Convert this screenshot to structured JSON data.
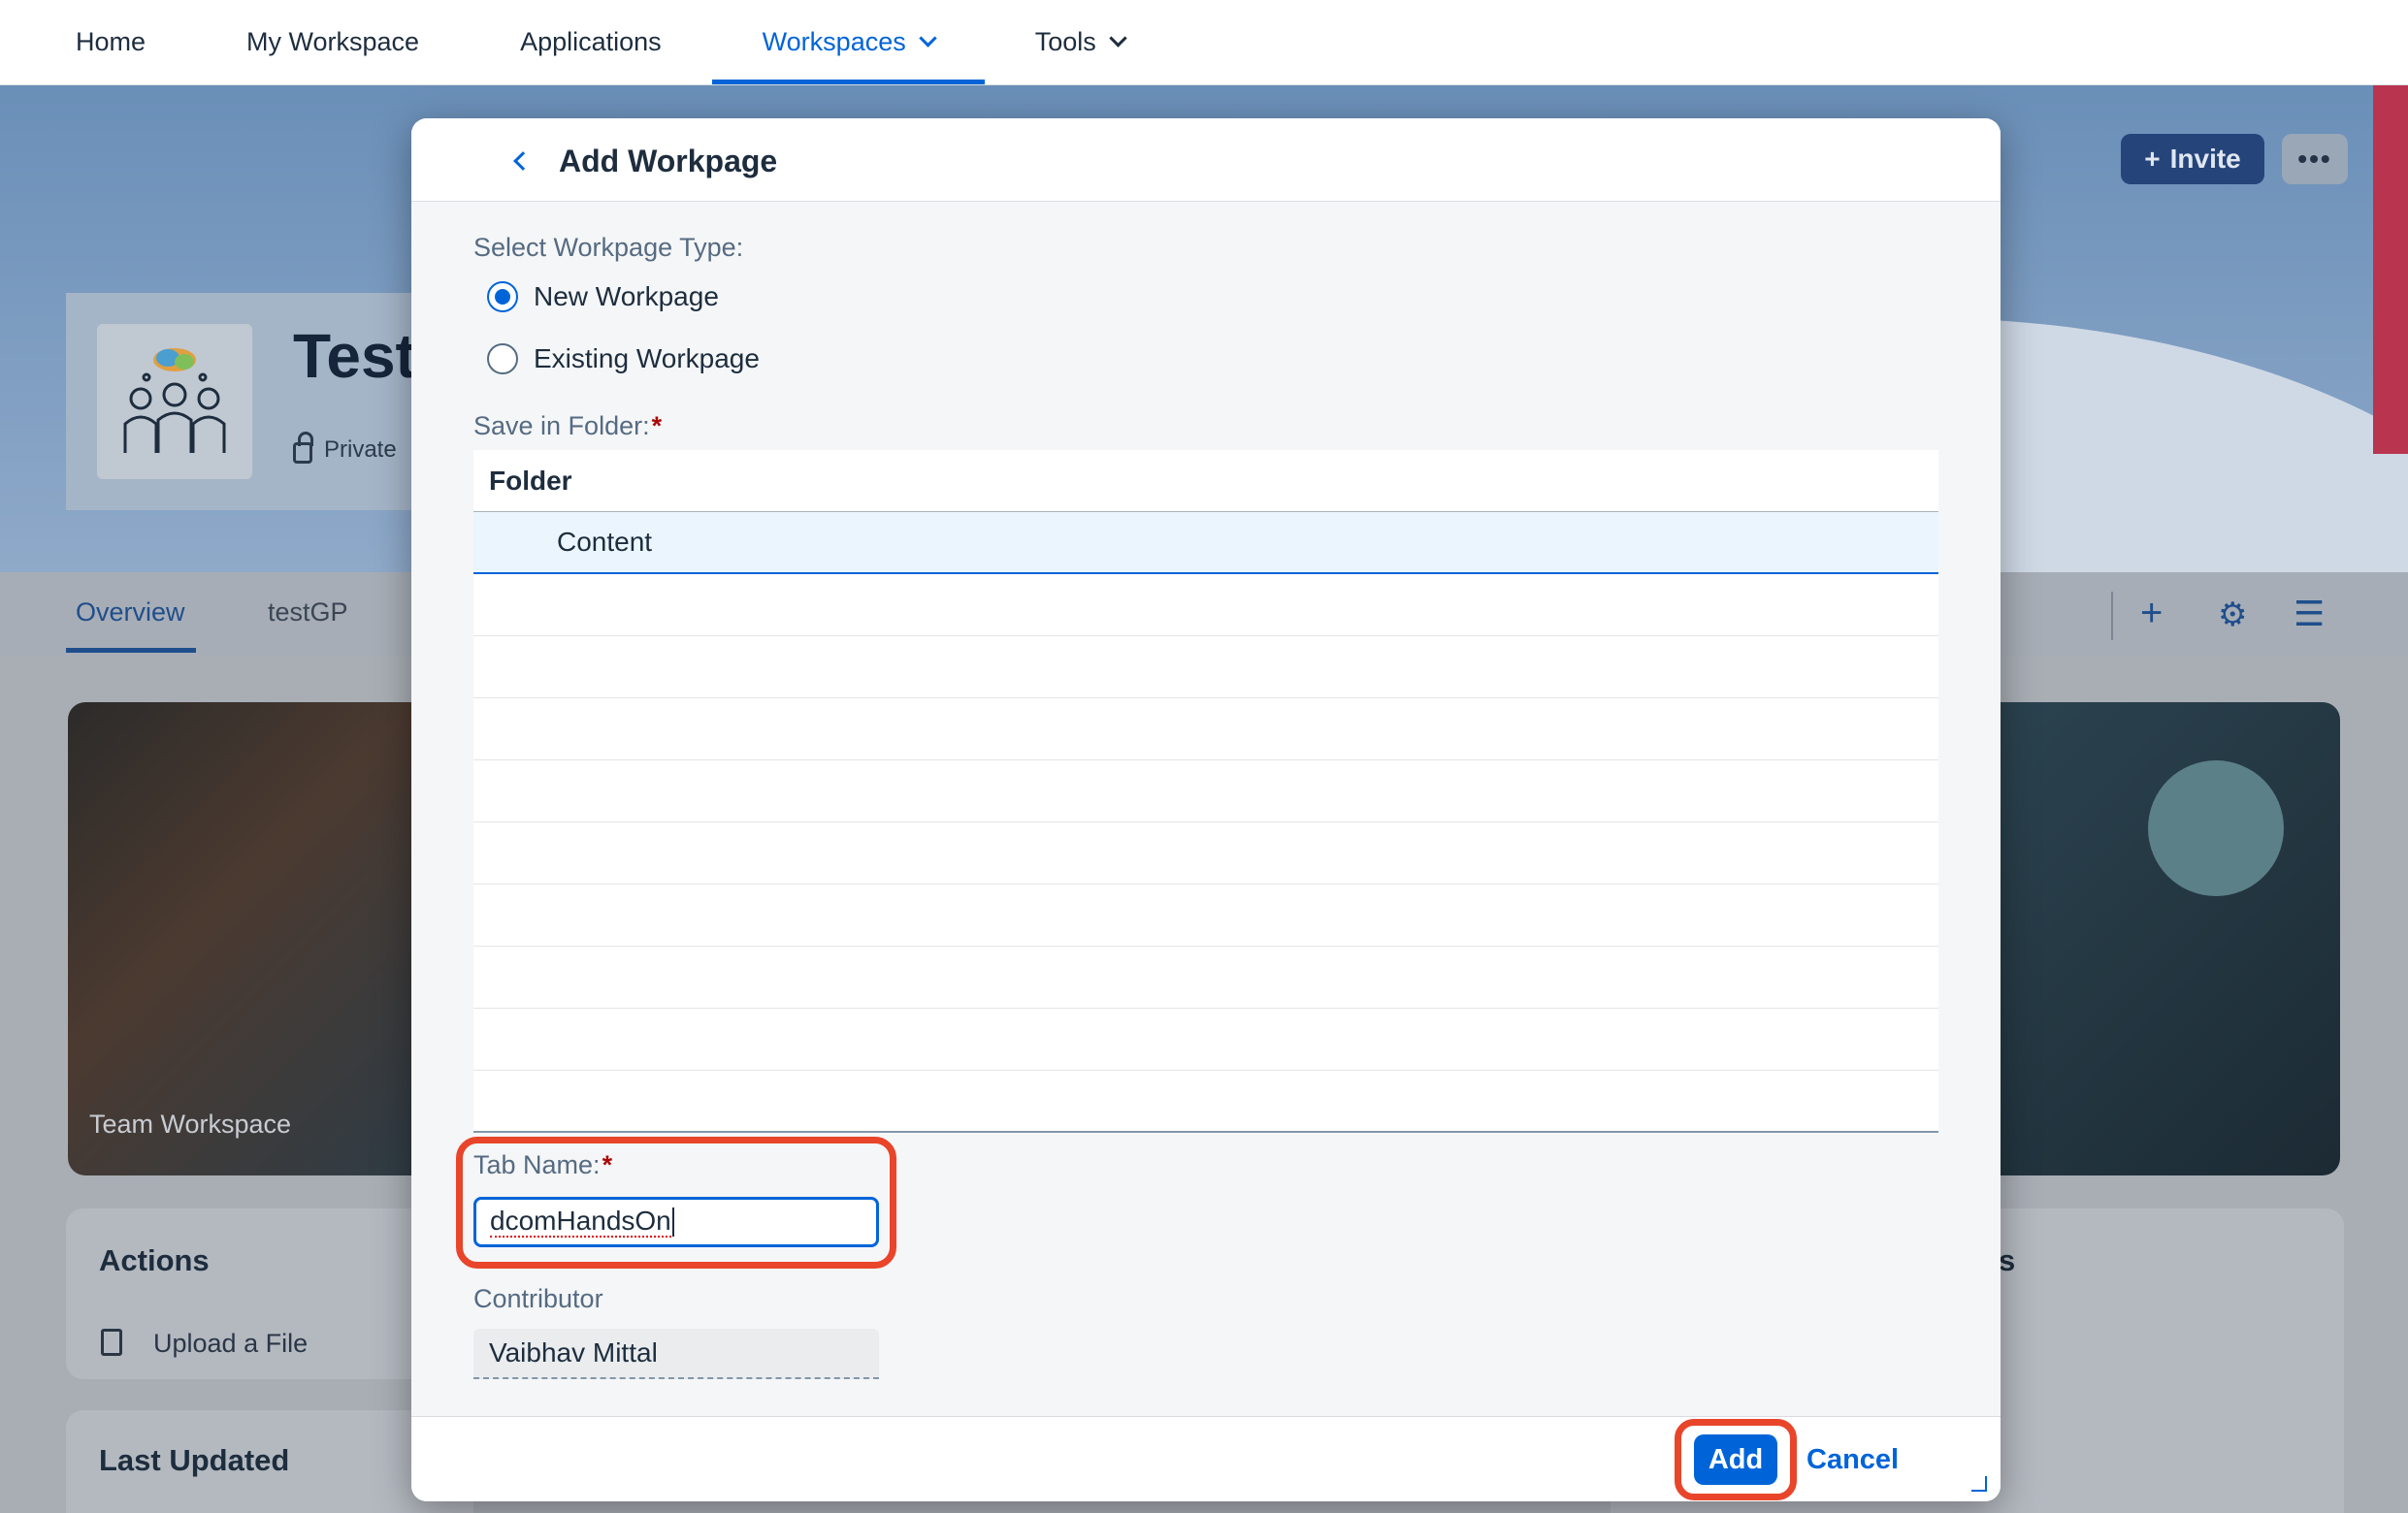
{
  "nav": {
    "items": [
      {
        "label": "Home"
      },
      {
        "label": "My Workspace"
      },
      {
        "label": "Applications"
      },
      {
        "label": "Workspaces"
      },
      {
        "label": "Tools"
      }
    ],
    "active": "Workspaces"
  },
  "workspace": {
    "title": "Test",
    "visibility": "Private",
    "invite_label": "Invite",
    "more_label": "•••",
    "tabs": [
      {
        "label": "Overview"
      },
      {
        "label": "testGP"
      }
    ],
    "banner_label": "Team Workspace",
    "actions_title": "Actions",
    "upload_label": "Upload a File",
    "last_updated_title": "Last Updated",
    "right_panel_fragment": "s"
  },
  "dialog": {
    "title": "Add Workpage",
    "type_label": "Select Workpage Type:",
    "options": [
      {
        "label": "New Workpage",
        "checked": true
      },
      {
        "label": "Existing Workpage",
        "checked": false
      }
    ],
    "folder_label": "Save in Folder:",
    "required_mark": "*",
    "table": {
      "header": "Folder",
      "rows": [
        "Content"
      ]
    },
    "tab_name_label": "Tab Name:",
    "tab_name_value": "dcomHandsOn",
    "contributor_label": "Contributor",
    "contributor_value": "Vaibhav Mittal",
    "add_label": "Add",
    "cancel_label": "Cancel"
  },
  "colors": {
    "accent": "#0064d9",
    "highlight": "#e8452a",
    "required": "#aa0808"
  }
}
